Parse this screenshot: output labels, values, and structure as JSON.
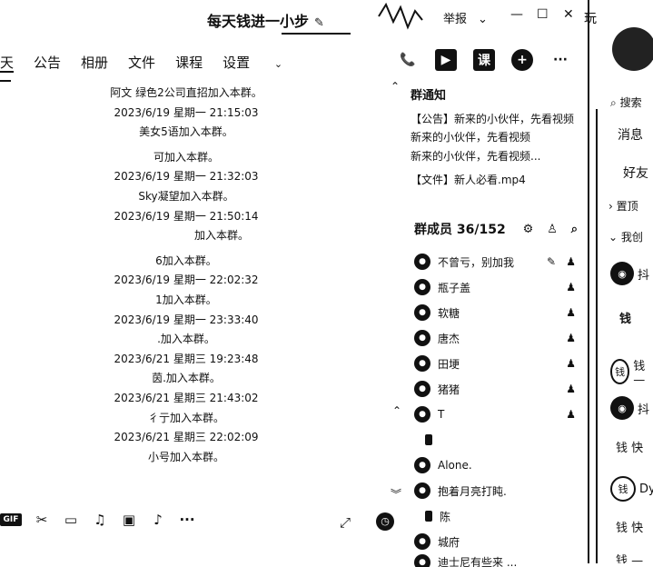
{
  "window": {
    "title": "每天钱进一小步",
    "report_label": "举报",
    "clipped_label": "玩"
  },
  "tabs": [
    {
      "label": "天"
    },
    {
      "label": "公告"
    },
    {
      "label": "相册"
    },
    {
      "label": "文件"
    },
    {
      "label": "课程"
    },
    {
      "label": "设置"
    }
  ],
  "log": [
    {
      "kind": "sys",
      "text": "阿文 绿色2公司直招加入本群。"
    },
    {
      "kind": "time",
      "text": "2023/6/19 星期一 21:15:03"
    },
    {
      "kind": "sys",
      "text": "美女5语加入本群。"
    },
    {
      "kind": "gap",
      "text": ""
    },
    {
      "kind": "sys",
      "text": "可加入本群。"
    },
    {
      "kind": "time",
      "text": "2023/6/19 星期一 21:32:03"
    },
    {
      "kind": "sys",
      "text": "Sky凝望加入本群。"
    },
    {
      "kind": "time",
      "text": "2023/6/19 星期一 21:50:14"
    },
    {
      "kind": "sys",
      "text": "加入本群。"
    },
    {
      "kind": "gap",
      "text": ""
    },
    {
      "kind": "sys",
      "text": "6加入本群。"
    },
    {
      "kind": "time",
      "text": "2023/6/19 星期一 22:02:32"
    },
    {
      "kind": "sys",
      "text": "1加入本群。"
    },
    {
      "kind": "time",
      "text": "2023/6/19 星期一 23:33:40"
    },
    {
      "kind": "sys",
      "text": ".加入本群。"
    },
    {
      "kind": "time",
      "text": "2023/6/21 星期三 19:23:48"
    },
    {
      "kind": "sys",
      "text": "茵.加入本群。"
    },
    {
      "kind": "time",
      "text": "2023/6/21 星期三 21:43:02"
    },
    {
      "kind": "sys",
      "text": "彳亍加入本群。"
    },
    {
      "kind": "time",
      "text": "2023/6/21 星期三 22:02:09"
    },
    {
      "kind": "sys",
      "text": "小号加入本群。"
    }
  ],
  "toolbar": {
    "gif_label": "GIF",
    "more_label": "···"
  },
  "header_icons": {
    "more_label": "···",
    "course_label": "课"
  },
  "notice": {
    "title": "群通知",
    "lines": [
      "【公告】新来的小伙伴，先看视频",
      "新来的小伙伴，先看视频",
      "新来的小伙伴，先看视频..."
    ],
    "file_line": "【文件】新人必看.mp4"
  },
  "members": {
    "title": "群成员 36/152",
    "list": [
      {
        "name": "不曾亏，别加我"
      },
      {
        "name": "瓶子盖"
      },
      {
        "name": "软糖"
      },
      {
        "name": "唐杰"
      },
      {
        "name": "田埂"
      },
      {
        "name": "猪猪"
      },
      {
        "name": "T"
      },
      {
        "name": ""
      },
      {
        "name": "Alone."
      },
      {
        "name": "抱着月亮打盹."
      },
      {
        "name": "陈"
      },
      {
        "name": "城府"
      },
      {
        "name": "迪士尼有些来 ..."
      }
    ]
  },
  "sidebar": {
    "search_label": "搜索",
    "messages_label": "消息",
    "friends_label": "好友",
    "pinned_label": "置顶",
    "my_created_label": "我创",
    "items": [
      {
        "label": "抖"
      },
      {
        "label": "钱"
      },
      {
        "label": "钱 —"
      },
      {
        "label": "抖"
      },
      {
        "label": "钱 快"
      },
      {
        "label": "Dy"
      },
      {
        "label": "钱 快"
      },
      {
        "label": "钱 —"
      }
    ]
  }
}
